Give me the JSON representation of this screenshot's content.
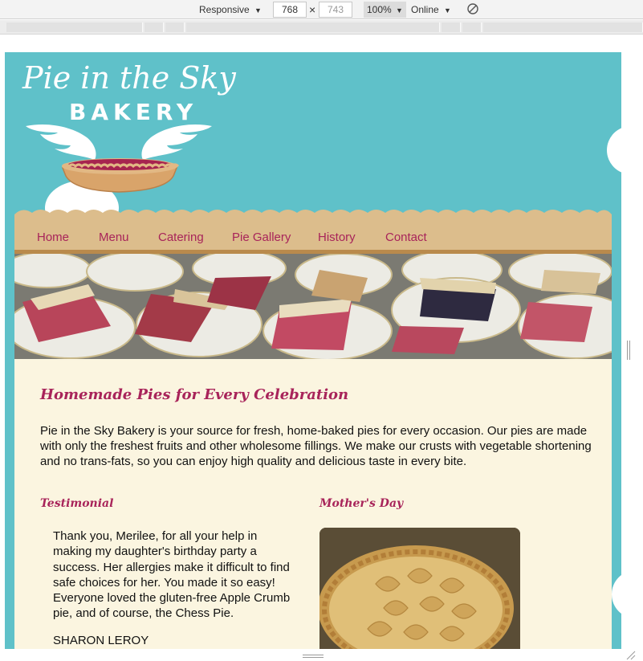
{
  "devtools": {
    "device": "Responsive",
    "width": "768",
    "times": "×",
    "height": "743",
    "zoom": "100%",
    "network": "Online",
    "dropdown_arrow": "▼"
  },
  "logo": {
    "script_text": "Pie in the Sky",
    "bakery_text": "BAKERY"
  },
  "nav": {
    "items": [
      "Home",
      "Menu",
      "Catering",
      "Pie Gallery",
      "History",
      "Contact"
    ]
  },
  "main": {
    "heading": "Homemade Pies for Every Celebration",
    "intro": "Pie in the Sky Bakery is your source for fresh, home-baked pies for every occasion. Our pies are made with only the freshest fruits and other wholesome fillings. We make our crusts with vegetable shortening and no trans-fats, so you can enjoy high quality and delicious taste in every bite.",
    "testimonial_heading": "Testimonial",
    "testimonial_text": "Thank you, Merilee, for all your help in making my daughter's birthday party a success. Her allergies make it difficult to find safe choices for her. You made it so easy! Everyone loved the gluten-free Apple Crumb pie, and of course, the Chess Pie.",
    "testimonial_author": "SHARON LEROY",
    "mothers_day_heading": "Mother's Day"
  },
  "colors": {
    "teal": "#5fc1c9",
    "nav_tan": "#dcbd8c",
    "accent": "#a8245a",
    "cream": "#fbf5e0"
  }
}
